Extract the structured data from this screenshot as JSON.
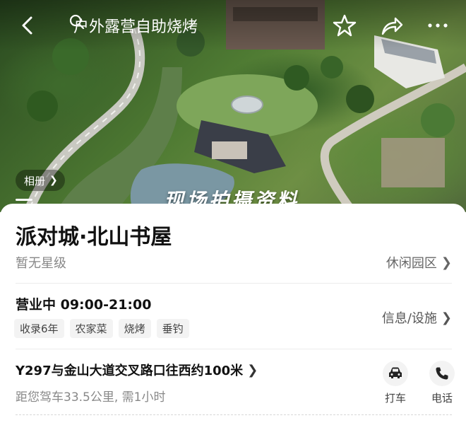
{
  "header": {
    "search_text": "户外露营自助烧烤"
  },
  "hero": {
    "album_label": "相册",
    "overlay_text": "现场拍摄资料"
  },
  "place": {
    "name": "派对城·北山书屋",
    "star_level": "暂无星级",
    "category": "休闲园区",
    "hours": "营业中 09:00-21:00",
    "tags": [
      "收录6年",
      "农家菜",
      "烧烤",
      "垂钓"
    ],
    "info_link": "信息/设施",
    "address": "Y297与金山大道交叉路口往西约100米",
    "distance": "距您驾车33.5公里, 需1小时"
  },
  "actions": {
    "taxi_label": "打车",
    "phone_label": "电话"
  },
  "icons": {
    "back": "back-arrow-icon",
    "search": "search-icon",
    "favorite": "star-outline-icon",
    "share": "share-icon",
    "more": "more-dots-icon",
    "taxi": "car-icon",
    "phone": "phone-icon"
  }
}
